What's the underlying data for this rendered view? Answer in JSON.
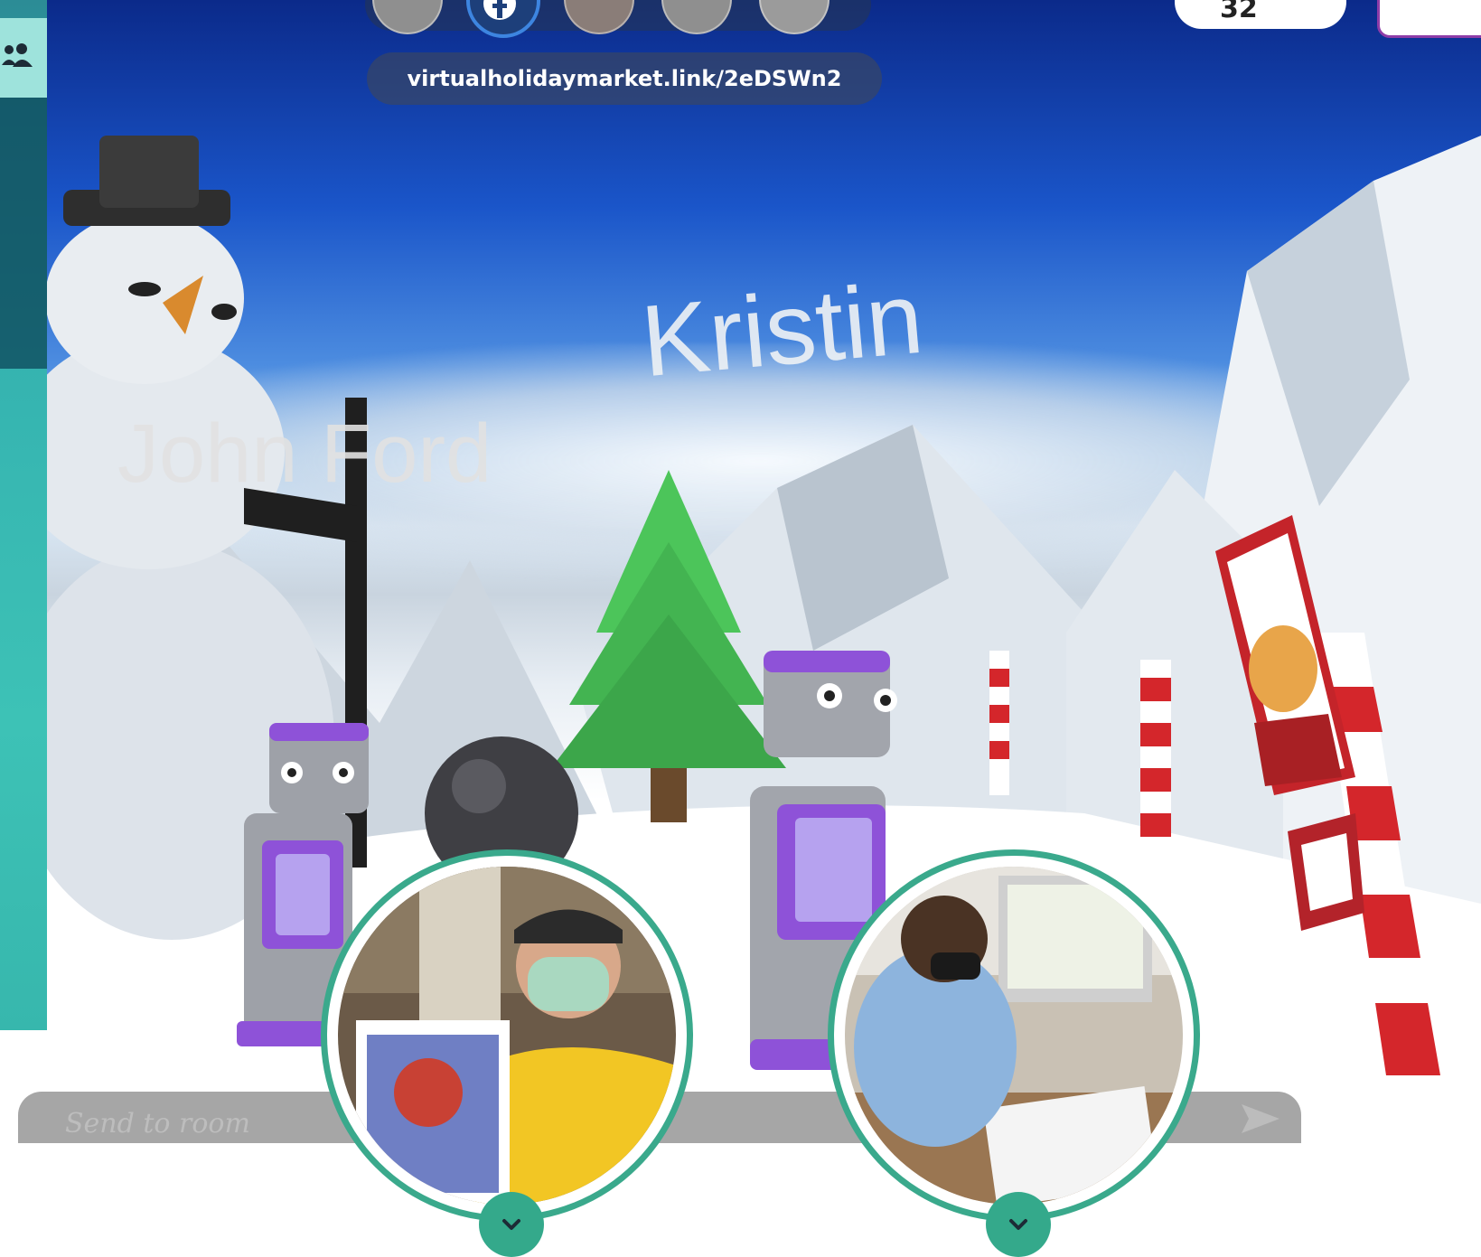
{
  "toolbar": {
    "avatars": [
      "avatar-1",
      "facebook-share",
      "avatar-3",
      "avatar-4",
      "avatar-5"
    ],
    "room_url": "virtualholidaymarket.link/2eDSWn2",
    "people_count": "32"
  },
  "scene": {
    "name_labels": {
      "kristin": "Kristin",
      "john": "John Ford"
    }
  },
  "chat": {
    "placeholder": "Send to room"
  },
  "colors": {
    "sidebar": "#3dc2b6",
    "bubble_ring": "#3aa98c",
    "active_avatar": "#3d85e0"
  }
}
